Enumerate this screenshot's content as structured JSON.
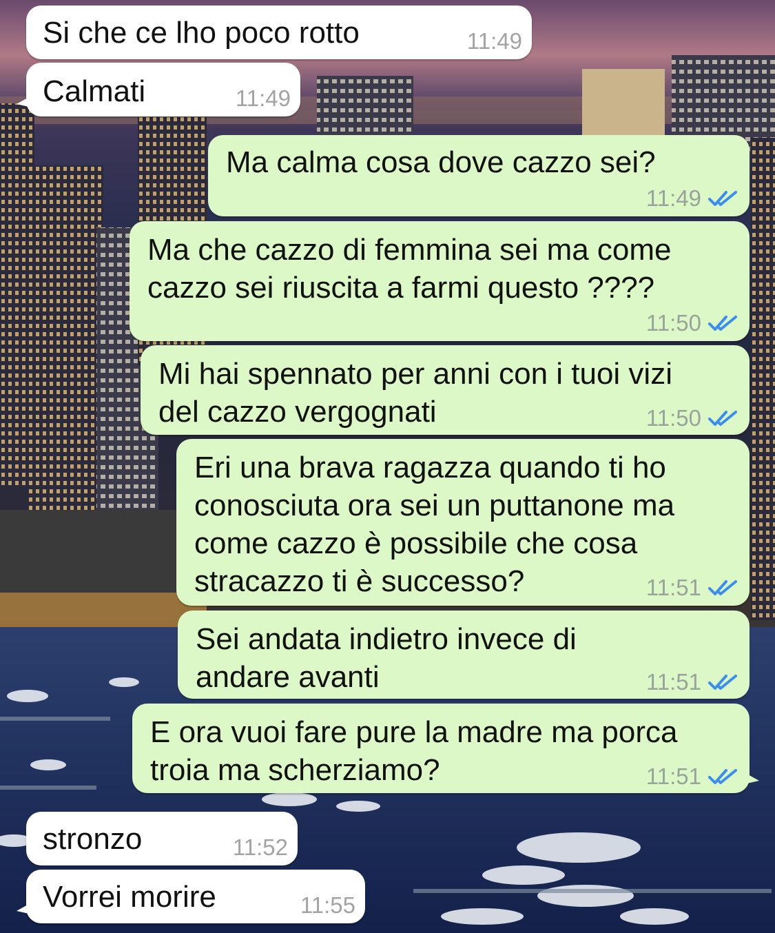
{
  "wallpaper": {
    "description_icon": "city-marina-night-wallpaper"
  },
  "colors": {
    "incoming_bubble": "#ffffff",
    "outgoing_bubble": "#dcf8c6",
    "time_text": "#9aa39a",
    "read_ticks": "#3b8ef0"
  },
  "messages": [
    {
      "direction": "in",
      "text": "Si che ce lho poco rotto",
      "time": "11:49"
    },
    {
      "direction": "in",
      "text": "Calmati",
      "time": "11:49"
    },
    {
      "direction": "out",
      "text": "Ma calma cosa dove cazzo sei?",
      "time": "11:49",
      "status_icon": "double-check-read-icon"
    },
    {
      "direction": "out",
      "text": "Ma che cazzo di femmina sei ma come\ncazzo sei riuscita a farmi questo ????",
      "time": "11:50",
      "status_icon": "double-check-read-icon"
    },
    {
      "direction": "out",
      "text": "Mi hai spennato per anni con i tuoi vizi\ndel cazzo vergognati",
      "time": "11:50",
      "status_icon": "double-check-read-icon"
    },
    {
      "direction": "out",
      "text": "Eri una brava ragazza quando ti ho\nconosciuta ora sei un puttanone ma\ncome cazzo è possibile che cosa\nstracazzo ti è successo?",
      "time": "11:51",
      "status_icon": "double-check-read-icon"
    },
    {
      "direction": "out",
      "text": "Sei andata indietro invece di\nandare avanti",
      "time": "11:51",
      "status_icon": "double-check-read-icon"
    },
    {
      "direction": "out",
      "text": "E ora vuoi fare pure la madre ma porca\ntroia ma scherziamo?",
      "time": "11:51",
      "status_icon": "double-check-read-icon"
    },
    {
      "direction": "in",
      "text": "stronzo",
      "time": "11:52"
    },
    {
      "direction": "in",
      "text": "Vorrei morire",
      "time": "11:55"
    }
  ]
}
